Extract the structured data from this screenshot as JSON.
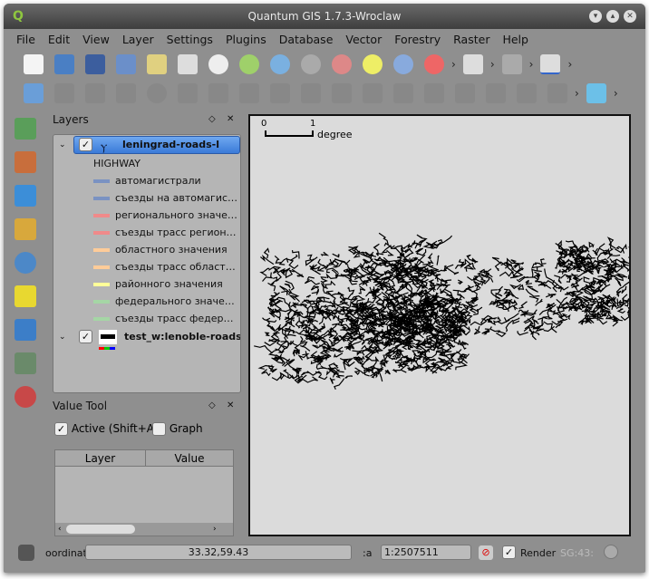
{
  "window": {
    "title": "Quantum GIS 1.7.3-Wroclaw"
  },
  "menu": [
    "File",
    "Edit",
    "View",
    "Layer",
    "Settings",
    "Plugins",
    "Database",
    "Vector",
    "Forestry",
    "Raster",
    "Help"
  ],
  "layers_panel": {
    "title": "Layers",
    "layers": [
      {
        "name": "leningrad-roads-l",
        "checked": true,
        "selected": true,
        "classification_field": "HIGHWAY",
        "classes": [
          {
            "label": "автомагистрали",
            "color": "#7a92c2"
          },
          {
            "label": "съезды на автомагис…",
            "color": "#7a92c2"
          },
          {
            "label": "регионального значе…",
            "color": "#f08a8a"
          },
          {
            "label": "съезды трасс регион…",
            "color": "#f08a8a"
          },
          {
            "label": "областного значения",
            "color": "#ffcc99"
          },
          {
            "label": "съезды трасс област…",
            "color": "#ffcc99"
          },
          {
            "label": "районного значения",
            "color": "#ffff99"
          },
          {
            "label": "федерального значе…",
            "color": "#a5d6a5"
          },
          {
            "label": "съезды трасс федер…",
            "color": "#a5d6a5"
          }
        ]
      },
      {
        "name": "test_w:lenoble-roads",
        "checked": true,
        "selected": false
      }
    ]
  },
  "value_tool": {
    "title": "Value Tool",
    "active_label": "Active (Shift+A)",
    "active": true,
    "graph_label": "Graph",
    "graph": false,
    "columns": [
      "Layer",
      "Value"
    ]
  },
  "map": {
    "scalebar_ticks": [
      "0",
      "1"
    ],
    "scalebar_unit": "degree"
  },
  "status": {
    "coord_label": "oordinat",
    "coord_value": "33.32,59.43",
    "scale_label": ":a",
    "scale_value": "1:2507511",
    "render_label": "Render",
    "render": true,
    "crs": "SG:43:"
  }
}
